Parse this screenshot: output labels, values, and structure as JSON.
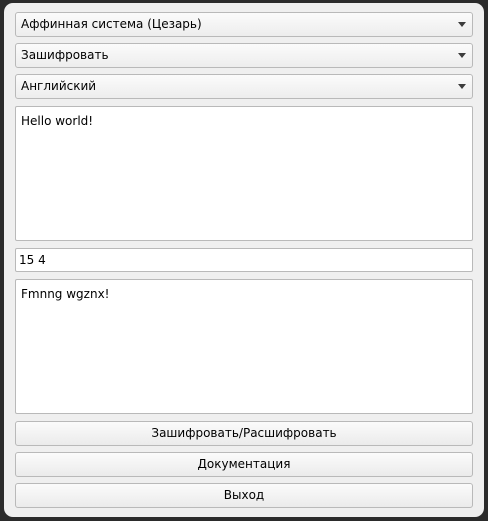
{
  "cipher_select": {
    "value": "Аффинная система (Цезарь)"
  },
  "mode_select": {
    "value": "Зашифровать"
  },
  "language_select": {
    "value": "Английский"
  },
  "input_text": {
    "value": "Hello world!"
  },
  "key_field": {
    "value": "15 4"
  },
  "output_text": {
    "value": "Fmnng wgznx!"
  },
  "buttons": {
    "encrypt_decrypt": "Зашифровать/Расшифровать",
    "documentation": "Документация",
    "exit": "Выход"
  }
}
